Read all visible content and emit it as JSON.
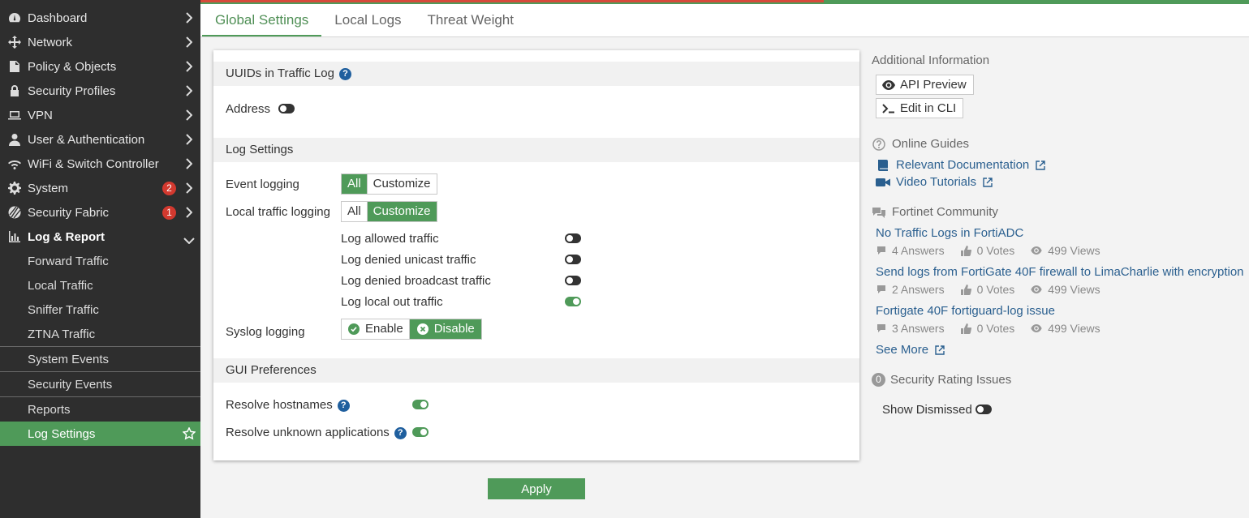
{
  "sidebar": {
    "items": [
      {
        "label": "Dashboard",
        "icon": "dashboard-icon"
      },
      {
        "label": "Network",
        "icon": "network-move-icon"
      },
      {
        "label": "Policy & Objects",
        "icon": "policy-document-icon"
      },
      {
        "label": "Security Profiles",
        "icon": "lock-icon"
      },
      {
        "label": "VPN",
        "icon": "laptop-icon"
      },
      {
        "label": "User & Authentication",
        "icon": "user-icon"
      },
      {
        "label": "WiFi & Switch Controller",
        "icon": "wifi-icon"
      },
      {
        "label": "System",
        "icon": "gear-icon",
        "badge": "2"
      },
      {
        "label": "Security Fabric",
        "icon": "fabric-icon",
        "badge": "1"
      },
      {
        "label": "Log & Report",
        "icon": "bar-chart-icon"
      }
    ],
    "sub_items": [
      {
        "label": "Forward Traffic"
      },
      {
        "label": "Local Traffic"
      },
      {
        "label": "Sniffer Traffic"
      },
      {
        "label": "ZTNA Traffic"
      },
      {
        "label": "System Events"
      },
      {
        "label": "Security Events"
      },
      {
        "label": "Reports"
      },
      {
        "label": "Log Settings"
      }
    ]
  },
  "tabs": [
    {
      "label": "Global Settings"
    },
    {
      "label": "Local Logs"
    },
    {
      "label": "Threat Weight"
    }
  ],
  "panel": {
    "uuid_section": {
      "title": "UUIDs in Traffic Log",
      "address_label": "Address"
    },
    "log_section": {
      "title": "Log Settings",
      "event_logging_label": "Event logging",
      "local_traffic_label": "Local traffic logging",
      "opt_all": "All",
      "opt_customize": "Customize",
      "log_allowed": "Log allowed traffic",
      "log_denied_unicast": "Log denied unicast traffic",
      "log_denied_broadcast": "Log denied broadcast traffic",
      "log_local_out": "Log local out traffic",
      "syslog_label": "Syslog logging",
      "opt_enable": "Enable",
      "opt_disable": "Disable"
    },
    "gui_section": {
      "title": "GUI Preferences",
      "resolve_hostnames": "Resolve hostnames",
      "resolve_apps": "Resolve unknown applications"
    },
    "help_glyph": "?"
  },
  "apply_label": "Apply",
  "right": {
    "additional_info": "Additional Information",
    "api_preview": "API Preview",
    "edit_cli": "Edit in CLI",
    "online_guides": "Online Guides",
    "relevant_docs": "Relevant Documentation",
    "video_tutorials": "Video Tutorials",
    "community": "Fortinet Community",
    "posts": [
      {
        "title": "No Traffic Logs in FortiADC",
        "answers": "4 Answers",
        "votes": "0 Votes",
        "views": "499 Views"
      },
      {
        "title": "Send logs from FortiGate 40F firewall to LimaCharlie with encryption",
        "answers": "2 Answers",
        "votes": "0 Votes",
        "views": "499 Views"
      },
      {
        "title": "Fortigate 40F fortiguard-log issue",
        "answers": "3 Answers",
        "votes": "0 Votes",
        "views": "499 Views"
      }
    ],
    "see_more": "See More",
    "security_rating_count": "0",
    "security_rating": "Security Rating Issues",
    "show_dismissed": "Show Dismissed"
  },
  "colors": {
    "accent": "#4f9a59",
    "badge": "#d3392f",
    "link": "#2a5f8f",
    "sidebar": "#2e2e2e"
  }
}
